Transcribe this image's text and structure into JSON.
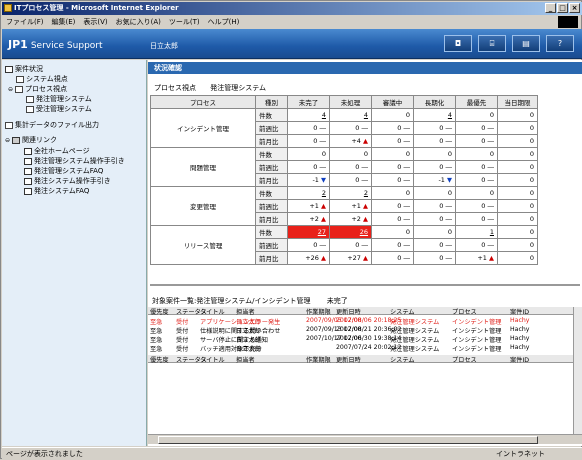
{
  "window": {
    "title": "ITプロセス管理 - Microsoft Internet Explorer"
  },
  "menu": [
    "ファイル(F)",
    "編集(E)",
    "表示(V)",
    "お気に入り(A)",
    "ツール(T)",
    "ヘルプ(H)"
  ],
  "header": {
    "brand": "JP1",
    "brand_sub": "Service Support",
    "user": "日立太郎"
  },
  "sidebar": {
    "items": [
      {
        "label": "案件状況"
      },
      {
        "label": "システム視点"
      },
      {
        "label": "プロセス視点"
      },
      {
        "label": "発注管理システム"
      },
      {
        "label": "受注管理システム"
      },
      {
        "label": "集計データのファイル出力"
      },
      {
        "label": "関連リンク"
      },
      {
        "label": "全社ホームページ"
      },
      {
        "label": "発注管理システム操作手引き"
      },
      {
        "label": "発注管理システムFAQ"
      },
      {
        "label": "発注システム操作手引き"
      },
      {
        "label": "発注システムFAQ"
      }
    ]
  },
  "main": {
    "section": "状況確認",
    "crumb1": "プロセス視点",
    "crumb2": "発注管理システム",
    "cols": [
      "プロセス",
      "種別",
      "未完了",
      "未処理",
      "審議中",
      "長期化",
      "最優先",
      "当日期限"
    ],
    "rows": [
      {
        "proc": "インシデント管理",
        "r": [
          [
            "件数",
            "4",
            "4",
            "0",
            "4",
            "0",
            "0"
          ],
          [
            "前週比",
            "0 ―",
            "0 ―",
            "0 ―",
            "0 ―",
            "0 ―",
            "0"
          ],
          [
            "前月比",
            "0 ―",
            "+4 ▲",
            "0 ―",
            "0 ―",
            "0 ―",
            "0"
          ]
        ]
      },
      {
        "proc": "問題管理",
        "r": [
          [
            "件数",
            "0",
            "0",
            "0",
            "0",
            "0",
            "0"
          ],
          [
            "前週比",
            "0 ―",
            "0 ―",
            "0 ―",
            "0 ―",
            "0 ―",
            "0"
          ],
          [
            "前月比",
            "-1 ▼",
            "0 ―",
            "0 ―",
            "-1 ▼",
            "0 ―",
            "0"
          ]
        ]
      },
      {
        "proc": "変更管理",
        "r": [
          [
            "件数",
            "2",
            "2",
            "0",
            "0",
            "0",
            "0"
          ],
          [
            "前週比",
            "+1 ▲",
            "+1 ▲",
            "0 ―",
            "0 ―",
            "0 ―",
            "0"
          ],
          [
            "前月比",
            "+2 ▲",
            "+2 ▲",
            "0 ―",
            "0 ―",
            "0 ―",
            "0"
          ]
        ]
      },
      {
        "proc": "リリース管理",
        "r": [
          [
            "件数",
            "27",
            "26",
            "0",
            "0",
            "1",
            "0"
          ],
          [
            "前週比",
            "0 ―",
            "0 ―",
            "0 ―",
            "0 ―",
            "0 ―",
            "0"
          ],
          [
            "前月比",
            "+26 ▲",
            "+27 ▲",
            "0 ―",
            "0 ―",
            "+1 ▲",
            "0"
          ]
        ]
      }
    ],
    "list_title": "対象案件一覧:発注管理システム/インシデント管理",
    "list_filter": "未完了",
    "list_cols": [
      "優先度",
      "ステータス",
      "タイトル",
      "担当者",
      "作業期限",
      "更新日時",
      "システム",
      "プロセス",
      "案件ID"
    ],
    "list_rows": [
      [
        "至急",
        "受付",
        "アプリケーションエラー発生",
        "日立太郎",
        "2007/09/05 12:00",
        "2007/08/06 20:18:25",
        "発注管理システム",
        "インシデント管理",
        "Hachy"
      ],
      [
        "至急",
        "受付",
        "仕様説明に関する問い合わせ",
        "日立太郎",
        "2007/09/13 12:00",
        "2007/08/21 20:36:02",
        "発注管理システム",
        "インシデント管理",
        "Hachy"
      ],
      [
        "至急",
        "受付",
        "サーバ停止に関する通知",
        "日立太郎",
        "2007/10/17 12:00",
        "2007/06/30 19:38:14",
        "発注管理システム",
        "インシデント管理",
        "Hachy"
      ],
      [
        "至急",
        "受付",
        "バッチ適用対象不充分",
        "日立太郎",
        "",
        "2007/07/24 20:02:12",
        "発注管理システム",
        "インシデント管理",
        "Hachy"
      ]
    ]
  },
  "status": {
    "left": "ページが表示されました",
    "right": "イントラネット"
  }
}
